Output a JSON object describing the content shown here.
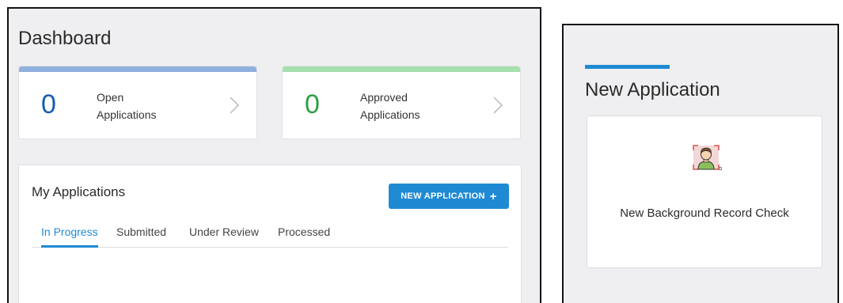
{
  "dashboard": {
    "title": "Dashboard",
    "open": {
      "count": "0",
      "label_line1": "Open",
      "label_line2": "Applications",
      "color": "#1a5cb0",
      "bar_color": "#8fb0dc"
    },
    "approved": {
      "count": "0",
      "label_line1": "Approved",
      "label_line2": "Applications",
      "color": "#2ea043",
      "bar_color": "#a5dfae"
    }
  },
  "applications": {
    "title": "My Applications",
    "new_button_label": "NEW APPLICATION",
    "new_button_icon": "plus-icon",
    "tabs": [
      {
        "label": "In Progress",
        "active": true
      },
      {
        "label": "Submitted",
        "active": false
      },
      {
        "label": "Under Review",
        "active": false
      },
      {
        "label": "Processed",
        "active": false
      }
    ]
  },
  "new_application": {
    "title": "New Application",
    "options": [
      {
        "label": "New Background Record Check",
        "icon": "person-scan-icon"
      }
    ]
  },
  "colors": {
    "accent": "#1f8ad3",
    "panel_bg": "#efeff1"
  }
}
